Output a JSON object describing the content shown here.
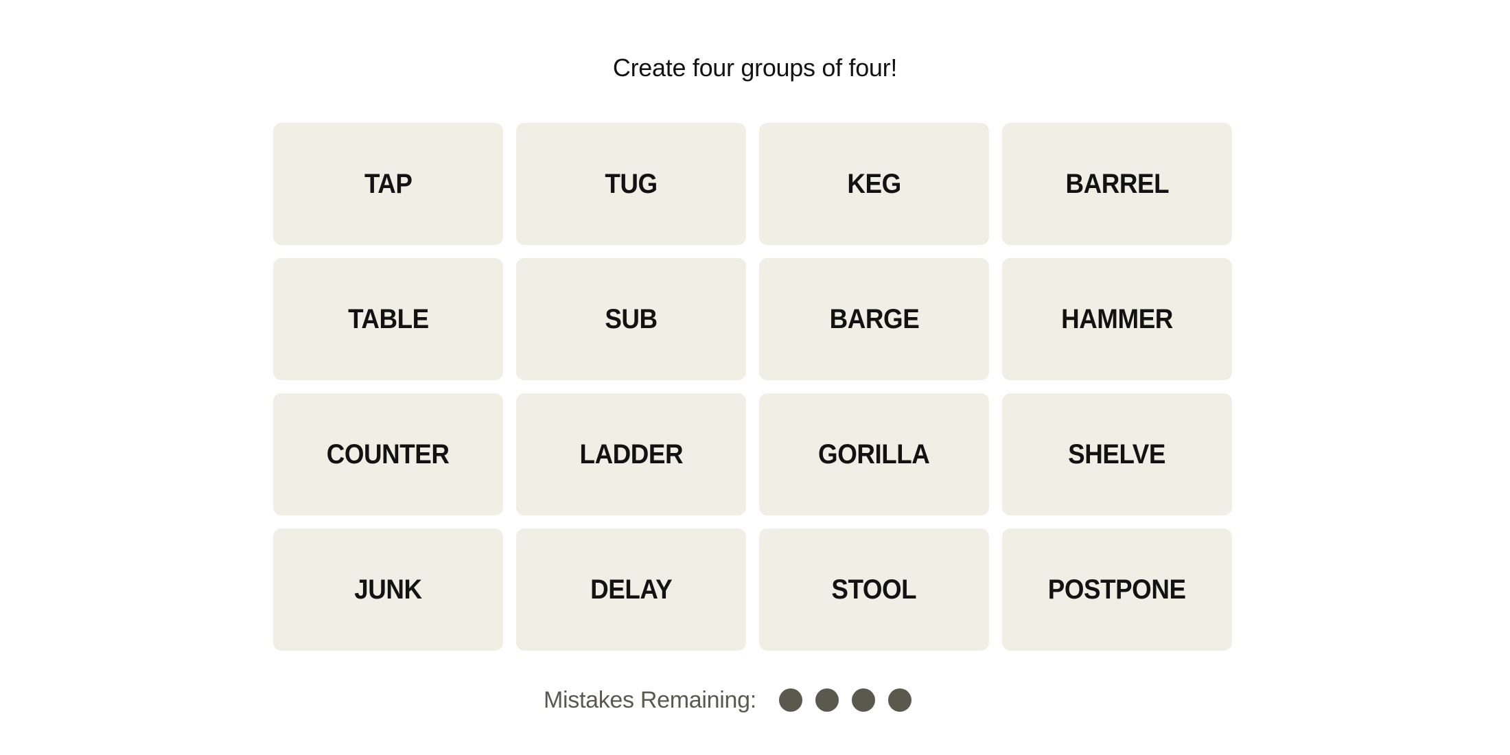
{
  "header": {
    "title": "Create four groups of four!"
  },
  "board": {
    "tiles": [
      "TAP",
      "TUG",
      "KEG",
      "BARREL",
      "TABLE",
      "SUB",
      "BARGE",
      "HAMMER",
      "COUNTER",
      "LADDER",
      "GORILLA",
      "SHELVE",
      "JUNK",
      "DELAY",
      "STOOL",
      "POSTPONE"
    ]
  },
  "mistakes": {
    "label": "Mistakes Remaining:",
    "remaining": 4,
    "total": 4,
    "dot_color": "#5a594e"
  },
  "colors": {
    "tile_bg": "#efefe6",
    "text": "#121212"
  }
}
